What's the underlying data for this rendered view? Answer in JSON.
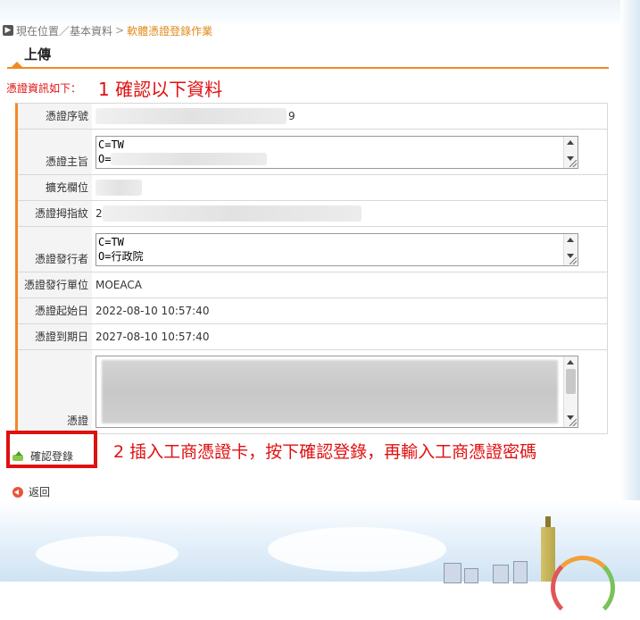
{
  "breadcrumb": {
    "icon": "arrow-right-icon",
    "location_label": "現在位置／基本資料",
    "separator": ">",
    "current": "軟體憑證登錄作業"
  },
  "page": {
    "title": "上傳",
    "notice": "憑證資訊如下：",
    "annotation_1": "1 確認以下資料",
    "annotation_2": "2 插入工商憑證卡，按下確認登錄，再輸入工商憑證密碼"
  },
  "form": {
    "serial_label": "憑證序號",
    "serial_suffix": "9",
    "subject_label": "憑證主旨",
    "subject_line1": "C=TW",
    "subject_line2": "O=",
    "extension_label": "擴充欄位",
    "thumbprint_label": "憑證拇指紋",
    "thumbprint_prefix": "2",
    "issuer_label": "憑證發行者",
    "issuer_line1": "C=TW",
    "issuer_line2": "O=行政院",
    "issuer_unit_label": "憑證發行單位",
    "issuer_unit_value": "MOEACA",
    "start_label": "憑證起始日",
    "start_value": "2022-08-10 10:57:40",
    "end_label": "憑證到期日",
    "end_value": "2027-08-10 10:57:40",
    "cert_label": "憑證"
  },
  "actions": {
    "confirm_label": "確認登錄",
    "confirm_icon": "upload-icon",
    "back_label": "返回",
    "back_icon": "back-icon"
  },
  "colors": {
    "accent": "#f08a24",
    "annotation": "#e01010",
    "breadcrumb_current": "#e08a1a"
  }
}
